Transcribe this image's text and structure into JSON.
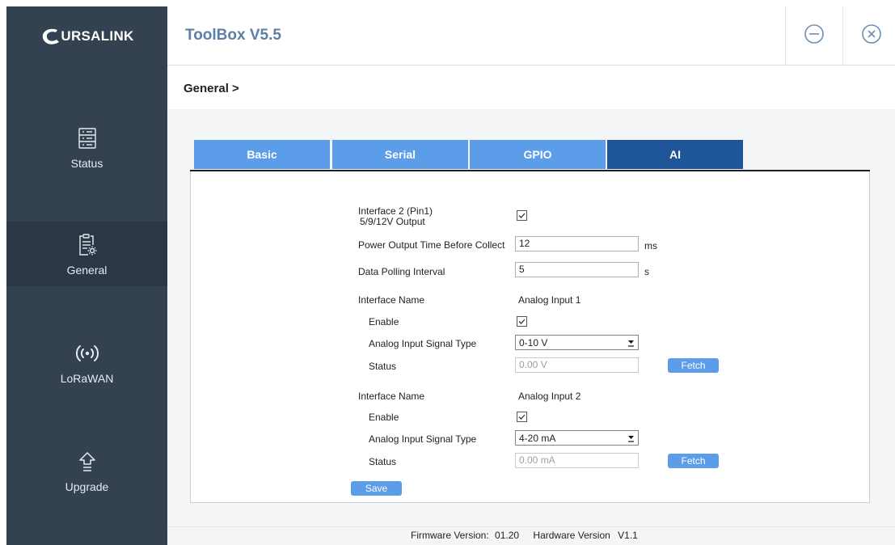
{
  "brand": {
    "logo_text": "URSALINK"
  },
  "header": {
    "title": "ToolBox V5.5"
  },
  "sidebar": {
    "items": [
      {
        "label": "Status",
        "icon": "server-icon"
      },
      {
        "label": "General",
        "icon": "document-gear-icon"
      },
      {
        "label": "LoRaWAN",
        "icon": "wireless-icon"
      },
      {
        "label": "Upgrade",
        "icon": "upload-arrow-icon"
      }
    ]
  },
  "breadcrumb": "General >",
  "tabs": [
    {
      "label": "Basic"
    },
    {
      "label": "Serial"
    },
    {
      "label": "GPIO"
    },
    {
      "label": "AI",
      "active": true
    }
  ],
  "form": {
    "interface2_label_line1": "Interface 2 (Pin1)",
    "interface2_label_line2": "5/9/12V Output",
    "interface2_checked": true,
    "power_output_label": "Power Output Time Before Collect",
    "power_output_value": "12",
    "power_output_unit": "ms",
    "polling_label": "Data Polling Interval",
    "polling_value": "5",
    "polling_unit": "s",
    "inputs": [
      {
        "interface_name_label": "Interface Name",
        "interface_name_value": "Analog Input 1",
        "enable_label": "Enable",
        "enabled": true,
        "signal_type_label": "Analog Input Signal Type",
        "signal_type_value": "0-10 V",
        "status_label": "Status",
        "status_value": "0.00 V",
        "fetch_label": "Fetch"
      },
      {
        "interface_name_label": "Interface Name",
        "interface_name_value": "Analog Input 2",
        "enable_label": "Enable",
        "enabled": true,
        "signal_type_label": "Analog Input Signal Type",
        "signal_type_value": "4-20 mA",
        "status_label": "Status",
        "status_value": "0.00 mA",
        "fetch_label": "Fetch"
      }
    ],
    "save_label": "Save"
  },
  "footer": {
    "firmware_label": "Firmware Version:",
    "firmware_value": "01.20",
    "hardware_label": "Hardware Version",
    "hardware_value": "V1.1"
  },
  "colors": {
    "sidebar": "#334150",
    "sidebar_active": "#2b3744",
    "tab": "#5b9de8",
    "tab_active": "#1f5599",
    "title": "#5b7fa6"
  }
}
